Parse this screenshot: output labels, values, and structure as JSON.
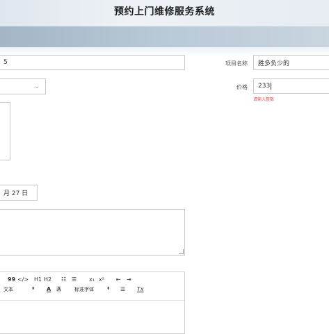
{
  "app": {
    "title": "预约上门维修服务系统"
  },
  "form": {
    "field1_value": "5",
    "project_name_label": "项目名称",
    "project_name_value": "胜多负少的",
    "price_label": "价格",
    "price_value": "233",
    "price_error": "请输入整数",
    "date_value": "月 27 日"
  },
  "editor_toolbar": {
    "row1": [
      "99",
      "</>",
      "H1",
      "H2",
      "☷",
      "☰",
      "x₁",
      "x²",
      "⇤",
      "⇥"
    ],
    "row2": {
      "size_label": "文本",
      "size_arrow": "⬍",
      "color_a": "A",
      "bg_a": "A",
      "font_label": "标准字体",
      "font_arrow": "⬍",
      "align": "☰",
      "clear": "Tx"
    }
  },
  "colors": {
    "header_bg": "#e6ecf2",
    "nav_bg": "#b3c4d2",
    "error": "#e05050"
  }
}
